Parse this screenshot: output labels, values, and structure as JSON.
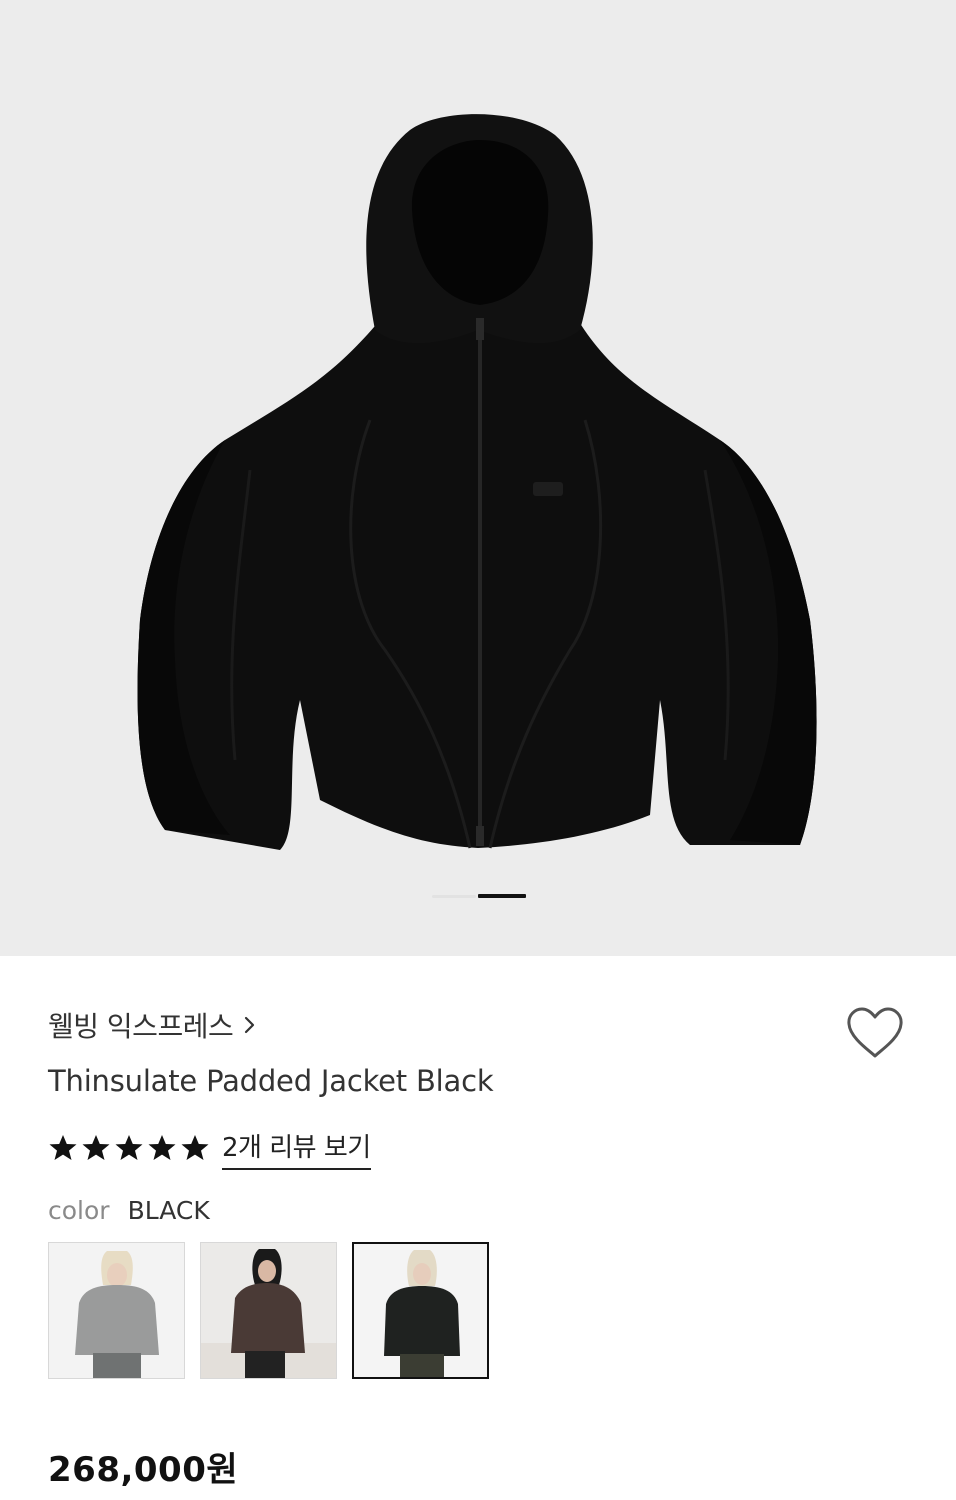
{
  "product": {
    "image_alt": "black padded hooded jacket",
    "gallery_total": 2,
    "gallery_current": 2,
    "brand": "웰빙 익스프레스",
    "title": "Thinsulate Padded Jacket Black",
    "rating": 5,
    "review_link": "2개 리뷰 보기",
    "color_label": "color",
    "color_value": "BLACK",
    "price": "268,000원",
    "swatches": [
      {
        "name": "grey",
        "color": "#9a9b9b",
        "selected": false
      },
      {
        "name": "brown",
        "color": "#4a3a36",
        "selected": false
      },
      {
        "name": "black",
        "color": "#1f2220",
        "selected": true
      }
    ]
  },
  "icons": {
    "brand_chevron": "chevron-right-icon",
    "wishlist": "heart-outline-icon",
    "star": "star-filled-icon"
  },
  "colors": {
    "hero_bg": "#ececec",
    "jacket": "#0d0d0d",
    "text_primary": "#1a1a1a",
    "text_muted": "#8a8a8a"
  }
}
